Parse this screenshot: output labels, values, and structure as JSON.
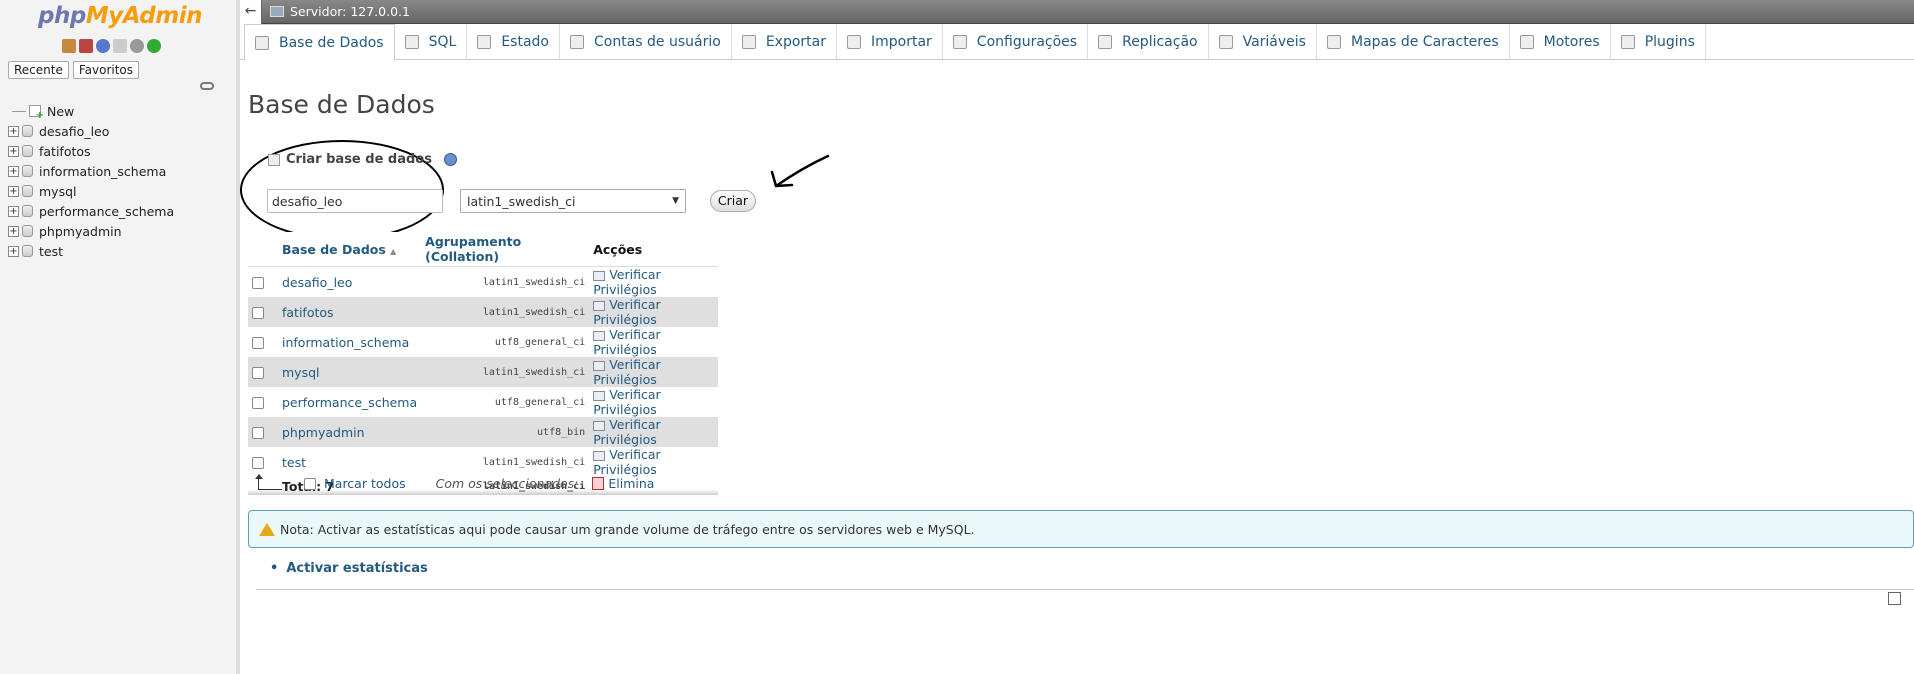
{
  "sidebar": {
    "logo": {
      "php": "php",
      "my": "My",
      "admin": "Admin"
    },
    "tabs": [
      "Recente",
      "Favoritos"
    ],
    "tree": [
      {
        "label": "New",
        "type": "new"
      },
      {
        "label": "desafio_leo"
      },
      {
        "label": "fatifotos"
      },
      {
        "label": "information_schema"
      },
      {
        "label": "mysql"
      },
      {
        "label": "performance_schema"
      },
      {
        "label": "phpmyadmin"
      },
      {
        "label": "test"
      }
    ]
  },
  "topbar": {
    "server": "Servidor: 127.0.0.1"
  },
  "tabs": [
    {
      "label": "Base de Dados",
      "icon": "database-icon"
    },
    {
      "label": "SQL",
      "icon": "sql-icon"
    },
    {
      "label": "Estado",
      "icon": "status-icon"
    },
    {
      "label": "Contas de usuário",
      "icon": "users-icon"
    },
    {
      "label": "Exportar",
      "icon": "export-icon"
    },
    {
      "label": "Importar",
      "icon": "import-icon"
    },
    {
      "label": "Configurações",
      "icon": "wrench-icon"
    },
    {
      "label": "Replicação",
      "icon": "replication-icon"
    },
    {
      "label": "Variáveis",
      "icon": "variables-icon"
    },
    {
      "label": "Mapas de Caracteres",
      "icon": "charset-icon"
    },
    {
      "label": "Motores",
      "icon": "engines-icon"
    },
    {
      "label": "Plugins",
      "icon": "plugins-icon"
    }
  ],
  "main": {
    "title": "Base de Dados",
    "create": {
      "title": "Criar base de dados",
      "name_value": "desafio_leo",
      "collation": "latin1_swedish_ci",
      "button": "Criar"
    },
    "table": {
      "headers": [
        "Base de Dados",
        "Agrupamento (Collation)",
        "Acções"
      ],
      "rows": [
        {
          "name": "desafio_leo",
          "collation": "latin1_swedish_ci",
          "action": "Verificar Privilégios"
        },
        {
          "name": "fatifotos",
          "collation": "latin1_swedish_ci",
          "action": "Verificar Privilégios"
        },
        {
          "name": "information_schema",
          "collation": "utf8_general_ci",
          "action": "Verificar Privilégios"
        },
        {
          "name": "mysql",
          "collation": "latin1_swedish_ci",
          "action": "Verificar Privilégios"
        },
        {
          "name": "performance_schema",
          "collation": "utf8_general_ci",
          "action": "Verificar Privilégios"
        },
        {
          "name": "phpmyadmin",
          "collation": "utf8_bin",
          "action": "Verificar Privilégios"
        },
        {
          "name": "test",
          "collation": "latin1_swedish_ci",
          "action": "Verificar Privilégios"
        }
      ],
      "total_label": "Total: 7",
      "total_collation": "latin1_swedish_ci"
    },
    "bulk": {
      "check_all": "Marcar todos",
      "with_selected": "Com os seleccionados:",
      "delete": "Elimina"
    },
    "notice": "Nota: Activar as estatísticas aqui pode causar um grande volume de tráfego entre os servidores web e MySQL.",
    "activate_link": "Activar estatísticas"
  }
}
